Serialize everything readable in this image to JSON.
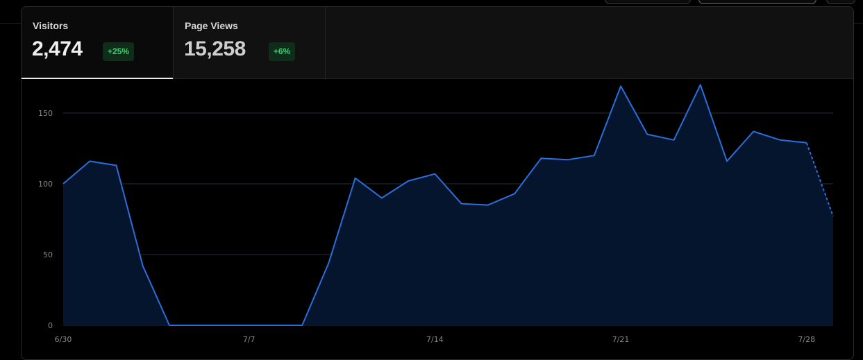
{
  "tabs": [
    {
      "label": "Visitors",
      "value": "2,474",
      "change": "+25%"
    },
    {
      "label": "Page Views",
      "value": "15,258",
      "change": "+6%"
    }
  ],
  "colors": {
    "line": "#2a6fdb",
    "area": "#05152e",
    "grid": "#262c33",
    "badge_text": "#3ecf6e",
    "badge_bg": "#0f2e1a"
  },
  "chart_data": {
    "type": "area",
    "title": "",
    "xlabel": "",
    "ylabel": "",
    "x": [
      "6/30",
      "7/1",
      "7/2",
      "7/3",
      "7/4",
      "7/5",
      "7/6",
      "7/7",
      "7/8",
      "7/9",
      "7/10",
      "7/11",
      "7/12",
      "7/13",
      "7/14",
      "7/15",
      "7/16",
      "7/17",
      "7/18",
      "7/19",
      "7/20",
      "7/21",
      "7/22",
      "7/23",
      "7/24",
      "7/25",
      "7/26",
      "7/27",
      "7/28",
      "7/29"
    ],
    "series": [
      {
        "values": [
          100,
          116,
          113,
          42,
          0,
          0,
          0,
          0,
          0,
          0,
          44,
          104,
          90,
          102,
          107,
          86,
          85,
          93,
          118,
          117,
          120,
          169,
          135,
          131,
          170,
          116,
          137,
          131,
          129,
          77
        ],
        "partial_from_index": 28
      }
    ],
    "xticks": [
      "6/30",
      "7/7",
      "7/14",
      "7/21",
      "7/28"
    ],
    "xtick_index": [
      0,
      7,
      14,
      21,
      28
    ],
    "yticks": [
      0,
      50,
      100,
      150
    ],
    "ylim": [
      0,
      180
    ],
    "grid": true,
    "legend": "none"
  }
}
